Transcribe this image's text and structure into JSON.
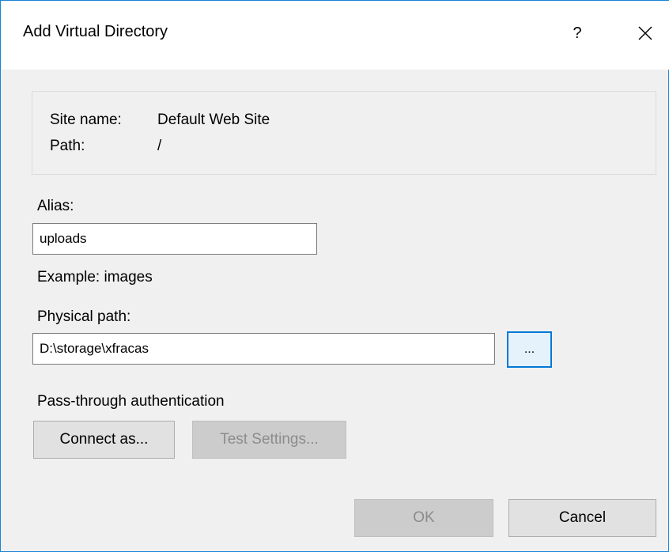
{
  "window": {
    "title": "Add Virtual Directory",
    "help_label": "?"
  },
  "info": {
    "site_name_label": "Site name:",
    "site_name_value": "Default Web Site",
    "path_label": "Path:",
    "path_value": "/"
  },
  "alias": {
    "label": "Alias:",
    "value": "uploads",
    "example": "Example: images"
  },
  "physical_path": {
    "label": "Physical path:",
    "value": "D:\\storage\\xfracas",
    "browse_label": "..."
  },
  "auth": {
    "label": "Pass-through authentication",
    "connect_label": "Connect as...",
    "test_label": "Test Settings..."
  },
  "footer": {
    "ok_label": "OK",
    "cancel_label": "Cancel"
  },
  "colors": {
    "accent": "#0078d7",
    "window_border": "#1883d7",
    "dialog_bg": "#f0f0f0"
  }
}
